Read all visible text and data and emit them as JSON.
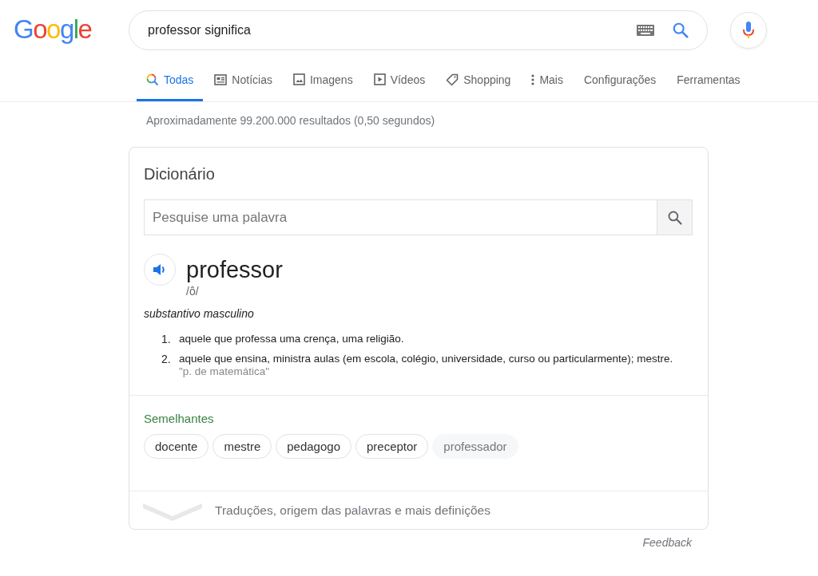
{
  "logo": "Google",
  "search": {
    "value": "professor significa"
  },
  "tabs": [
    {
      "label": "Todas",
      "kind": "search",
      "selected": true
    },
    {
      "label": "Notícias",
      "kind": "news",
      "selected": false
    },
    {
      "label": "Imagens",
      "kind": "image",
      "selected": false
    },
    {
      "label": "Vídeos",
      "kind": "video",
      "selected": false
    },
    {
      "label": "Shopping",
      "kind": "tag",
      "selected": false
    },
    {
      "label": "Mais",
      "kind": "more",
      "selected": false
    },
    {
      "label": "Configurações",
      "kind": "text",
      "selected": false
    },
    {
      "label": "Ferramentas",
      "kind": "text",
      "selected": false
    }
  ],
  "result_stats": "Aproximadamente 99.200.000 resultados (0,50 segundos)",
  "dictionary": {
    "title": "Dicionário",
    "search_placeholder": "Pesquise uma palavra",
    "word": "professor",
    "phonetic": "/ô/",
    "part_of_speech": "substantivo masculino",
    "definitions": [
      {
        "number": "1.",
        "text": "aquele que professa uma crença, uma religião."
      },
      {
        "number": "2.",
        "text": "aquele que ensina, ministra aulas (em escola, colégio, universidade, curso ou particularmente); mestre.",
        "example": "\"p. de matemática\""
      }
    ],
    "similar_title": "Semelhantes",
    "similar": [
      {
        "label": "docente",
        "kind": "outlined"
      },
      {
        "label": "mestre",
        "kind": "outlined"
      },
      {
        "label": "pedagogo",
        "kind": "outlined"
      },
      {
        "label": "preceptor",
        "kind": "outlined"
      },
      {
        "label": "professador",
        "kind": "faded"
      }
    ],
    "more_link": "Traduções, origem das palavras e mais definições"
  },
  "feedback": "Feedback"
}
